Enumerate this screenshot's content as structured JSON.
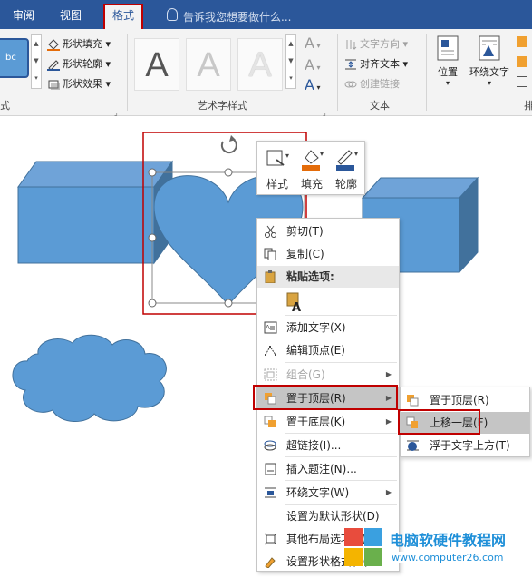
{
  "tabs": {
    "review": "审阅",
    "view": "视图",
    "format": "格式",
    "tell_me": "告诉我您想要做什么..."
  },
  "ribbon": {
    "shape_styles": {
      "sample": "bc",
      "fill": "形状填充",
      "outline": "形状轮廓",
      "effects": "形状效果",
      "group_label_partial": "式"
    },
    "wordart": {
      "group_label": "艺术字样式",
      "letter": "A"
    },
    "text": {
      "direction": "文字方向",
      "align": "对齐文本",
      "link": "创建链接",
      "group_label": "文本"
    },
    "arrange": {
      "position": "位置",
      "wrap": "环绕文字",
      "partial": "排"
    }
  },
  "mini_toolbar": {
    "style": "样式",
    "fill": "填充",
    "outline": "轮廓"
  },
  "context_menu": {
    "cut": "剪切(T)",
    "copy": "复制(C)",
    "paste_header": "粘贴选项:",
    "add_text": "添加文字(X)",
    "edit_points": "编辑顶点(E)",
    "group": "组合(G)",
    "bring_to_front": "置于顶层(R)",
    "send_to_back": "置于底层(K)",
    "hyperlink": "超链接(I)...",
    "insert_caption": "插入题注(N)...",
    "wrap_text": "环绕文字(W)",
    "set_default": "设置为默认形状(D)",
    "more_layout": "其他布局选项(L)...",
    "format_shape": "设置形状格式(O)..."
  },
  "submenu": {
    "bring_to_front": "置于顶层(R)",
    "bring_forward": "上移一层(F)",
    "in_front_of_text": "浮于文字上方(T)"
  },
  "watermark": {
    "title": "电脑软硬件教程网",
    "url": "www.computer26.com"
  },
  "colors": {
    "ribbon_blue": "#2b579a",
    "shape_blue": "#5b9bd5",
    "shape_dark": "#41719c",
    "highlight_red": "#c00000",
    "menu_hover": "#c5c5c5"
  }
}
